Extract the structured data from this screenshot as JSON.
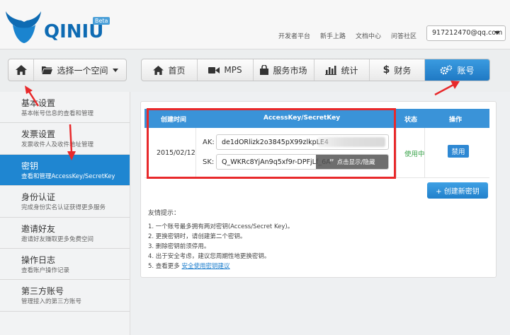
{
  "header": {
    "logo_text": "QINIU",
    "beta_label": "Beta",
    "links": [
      "开发者平台",
      "新手上路",
      "文档中心",
      "问答社区"
    ],
    "account": "917212470@qq.com"
  },
  "nav": {
    "home_icon": "home-icon",
    "space_selector": "选择一个空间",
    "tabs": [
      {
        "label": "首页",
        "icon": "home-icon"
      },
      {
        "label": "MPS",
        "icon": "video-icon"
      },
      {
        "label": "服务市场",
        "icon": "bag-icon"
      },
      {
        "label": "统计",
        "icon": "bar-chart-icon"
      },
      {
        "label": "财务",
        "icon": "dollar-icon"
      },
      {
        "label": "账号",
        "icon": "gears-icon"
      }
    ]
  },
  "sidebar": {
    "items": [
      {
        "title": "基本设置",
        "desc": "基本帐号信息的查看和管理"
      },
      {
        "title": "发票设置",
        "desc": "发票收件人及收件地址管理"
      },
      {
        "title": "密钥",
        "desc": "查看和管理AccessKey/SecretKey"
      },
      {
        "title": "身份认证",
        "desc": "完成身份实名认证获得更多服务"
      },
      {
        "title": "邀请好友",
        "desc": "邀请好友赚取更多免费空间"
      },
      {
        "title": "操作日志",
        "desc": "查看账户操作记录"
      },
      {
        "title": "第三方账号",
        "desc": "管理接入的第三方账号"
      }
    ],
    "active_index": 2
  },
  "keys_table": {
    "headers": {
      "created": "创建时间",
      "keys": "AccessKey/SecretKey",
      "status": "状态",
      "action": "操作"
    },
    "row": {
      "date": "2015/02/12",
      "ak_label": "AK:",
      "ak_value": "de1dORlizk2o3845pX99zlkpLE4",
      "sk_label": "SK:",
      "sk_value": "Q_WKRc8YjAn9q5xf9r-DPFjLf_6A",
      "reveal_label": "点击显示/隐藏",
      "status": "使用中",
      "action_label": "禁用"
    },
    "create_label": "+ 创建新密钥"
  },
  "tips": {
    "title": "友情提示：",
    "items": [
      "1.  一个账号最多拥有两对密钥(Access/Secret Key)。",
      "2.  更换密钥时，请创建第二个密钥。",
      "3.  删除密钥前须停用。",
      "4.  出于安全考虑，建议您周期性地更换密钥。"
    ],
    "last_prefix": "5.  查看更多 ",
    "last_link": "安全使用密钥建议"
  },
  "colors": {
    "accent": "#1f86d1",
    "highlight": "#e8292b",
    "status_green": "#3aa34a"
  }
}
